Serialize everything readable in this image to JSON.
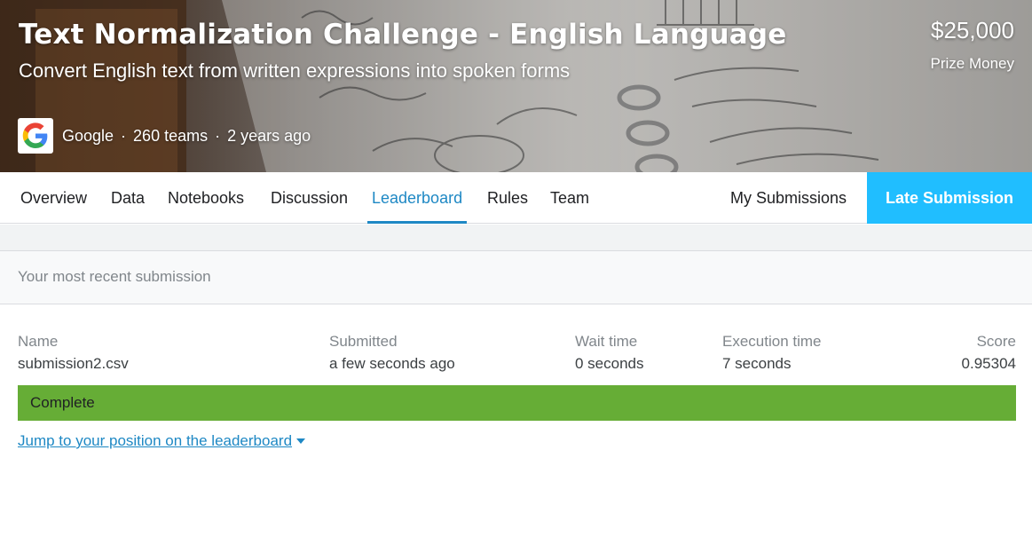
{
  "banner": {
    "title": "Text Normalization Challenge - English Language",
    "subtitle": "Convert English text from written expressions into spoken forms",
    "prize_amount": "$25,000",
    "prize_label": "Prize Money",
    "host": "Google",
    "teams": "260 teams",
    "age": "2 years ago",
    "host_logo_icon": "google-logo-icon"
  },
  "nav": {
    "tabs": [
      "Overview",
      "Data",
      "Notebooks",
      "Discussion",
      "Leaderboard",
      "Rules",
      "Team"
    ],
    "active_tab": "Leaderboard",
    "my_submissions": "My Submissions",
    "late_submission": "Late Submission"
  },
  "submission": {
    "section_title": "Your most recent submission",
    "headers": {
      "name": "Name",
      "submitted": "Submitted",
      "wait_time": "Wait time",
      "execution_time": "Execution time",
      "score": "Score"
    },
    "values": {
      "name": "submission2.csv",
      "submitted": "a few seconds ago",
      "wait_time": "0 seconds",
      "execution_time": "7 seconds",
      "score": "0.95304"
    },
    "status": "Complete",
    "status_color": "#66ad36",
    "jump_link": "Jump to your position on the leaderboard"
  },
  "colors": {
    "accent": "#1e88c4",
    "late_button": "#20beff"
  }
}
